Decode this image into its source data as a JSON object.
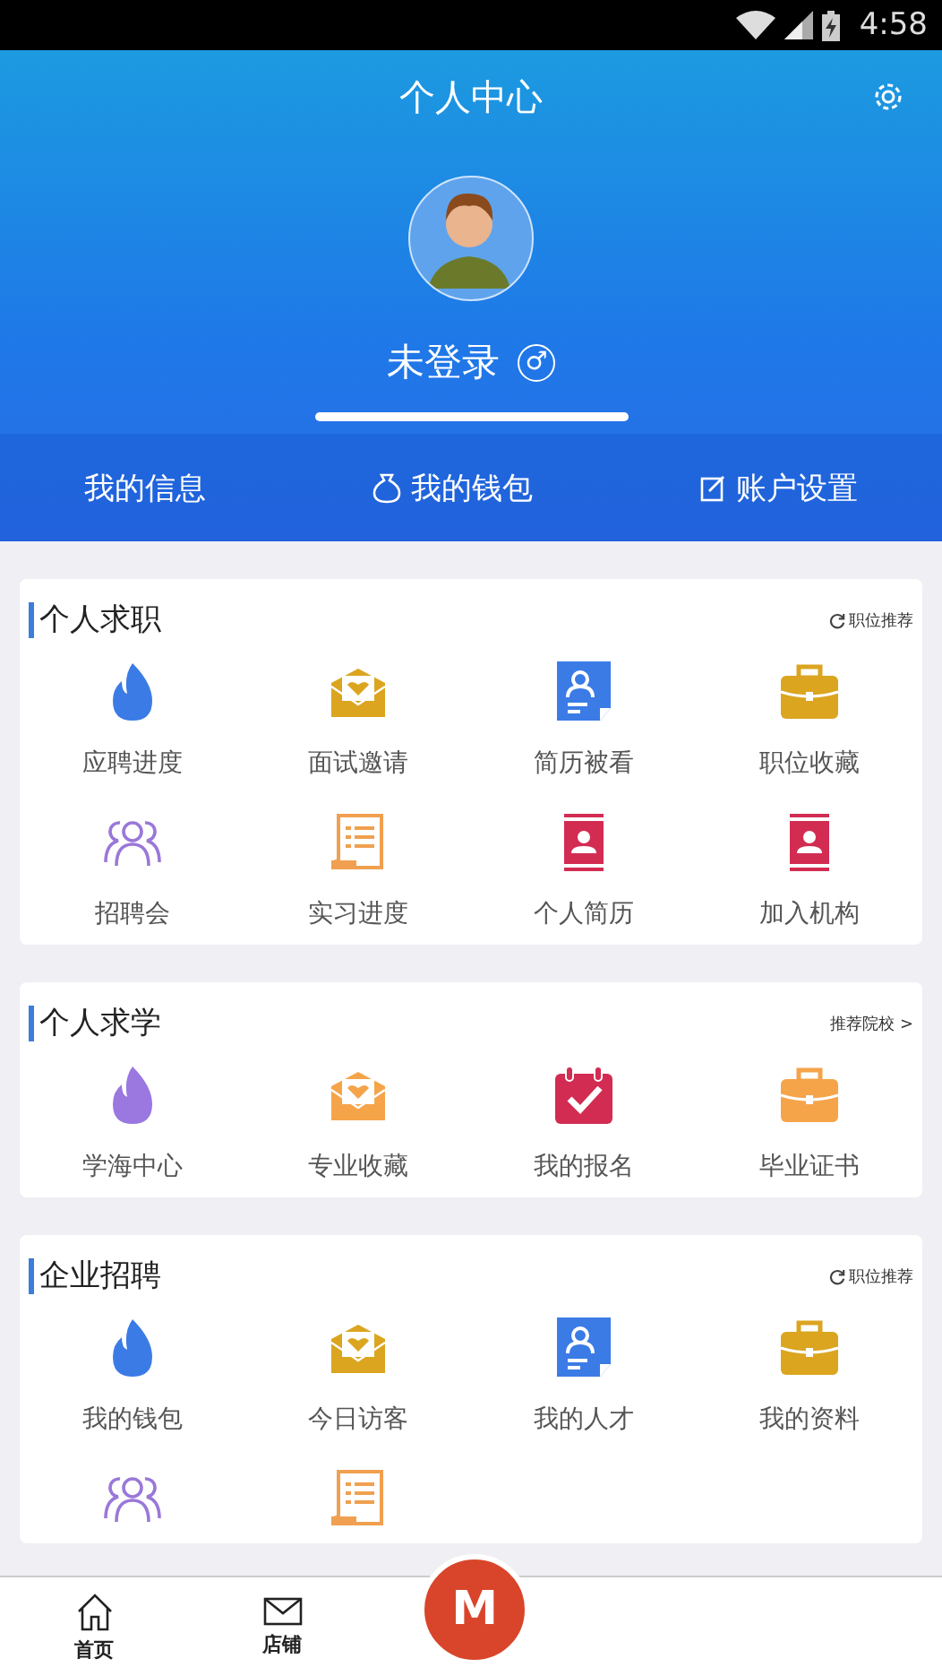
{
  "status_bar": {
    "time": "4:58"
  },
  "header": {
    "title": "个人中心",
    "user_name": "未登录",
    "gender_symbol": "♂"
  },
  "quick_links": [
    {
      "label": "我的信息"
    },
    {
      "label": "我的钱包"
    },
    {
      "label": "账户设置"
    }
  ],
  "sections": [
    {
      "title": "个人求职",
      "link": "职位推荐",
      "kind": "refresh",
      "items": [
        {
          "label": "应聘进度",
          "kind": "flame",
          "color": "#3b7be6"
        },
        {
          "label": "面试邀请",
          "kind": "envelope",
          "color": "#dba520"
        },
        {
          "label": "简历被看",
          "kind": "resume",
          "color": "#3b7be6"
        },
        {
          "label": "职位收藏",
          "kind": "briefcase",
          "color": "#dba520"
        },
        {
          "label": "招聘会",
          "kind": "people",
          "color": "#9a78d8"
        },
        {
          "label": "实习进度",
          "kind": "scroll",
          "color": "#f0a050"
        },
        {
          "label": "个人简历",
          "kind": "card",
          "color": "#d22c52"
        },
        {
          "label": "加入机构",
          "kind": "card",
          "color": "#d22c52"
        }
      ]
    },
    {
      "title": "个人求学",
      "link": "推荐院校 >",
      "kind": "plain",
      "items": [
        {
          "label": "学海中心",
          "kind": "flame",
          "color": "#9a78e0"
        },
        {
          "label": "专业收藏",
          "kind": "envelope",
          "color": "#f5a44a"
        },
        {
          "label": "我的报名",
          "kind": "calendar",
          "color": "#d22c52"
        },
        {
          "label": "毕业证书",
          "kind": "briefcase",
          "color": "#f5a44a"
        }
      ]
    },
    {
      "title": "企业招聘",
      "link": "职位推荐",
      "kind": "refresh",
      "items": [
        {
          "label": "我的钱包",
          "kind": "flame",
          "color": "#3b7be6"
        },
        {
          "label": "今日访客",
          "kind": "envelope",
          "color": "#dba520"
        },
        {
          "label": "我的人才",
          "kind": "resume",
          "color": "#3b7be6"
        },
        {
          "label": "我的资料",
          "kind": "briefcase",
          "color": "#dba520"
        },
        {
          "kind": "people",
          "color": "#9a78d8"
        },
        {
          "kind": "scroll",
          "color": "#f0a050"
        }
      ]
    }
  ],
  "bottom_nav": [
    {
      "label": "首页"
    },
    {
      "label": "店铺"
    }
  ],
  "center_button": {
    "letter": "M"
  }
}
